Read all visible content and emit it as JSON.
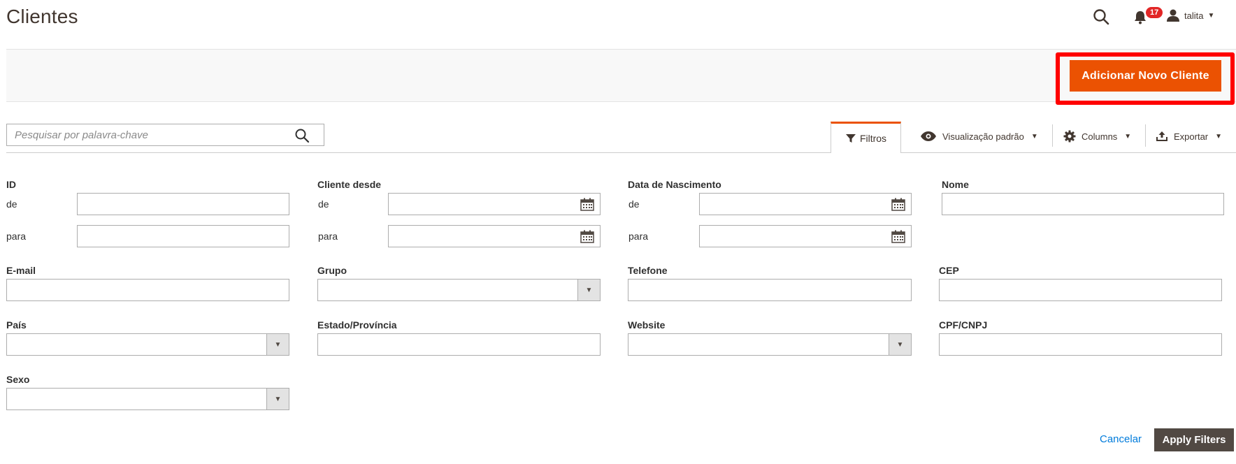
{
  "page": {
    "title": "Clientes"
  },
  "header": {
    "notifications_count": "17",
    "user_name": "talita"
  },
  "action_bar": {
    "add_button_label": "Adicionar Novo Cliente"
  },
  "search": {
    "placeholder": "Pesquisar por palavra-chave"
  },
  "toolbar": {
    "filters_label": "Filtros",
    "view_label": "Visualização padrão",
    "columns_label": "Columns",
    "export_label": "Exportar"
  },
  "filters": {
    "from_label": "de",
    "to_label": "para",
    "id": "ID",
    "customer_since": "Cliente desde",
    "birth_date": "Data de Nascimento",
    "name": "Nome",
    "email": "E-mail",
    "group": "Grupo",
    "phone": "Telefone",
    "zip": "CEP",
    "country": "País",
    "state": "Estado/Província",
    "website": "Website",
    "tax_id": "CPF/CNPJ",
    "gender": "Sexo"
  },
  "footer": {
    "cancel_label": "Cancelar",
    "apply_label": "Apply Filters"
  },
  "colors": {
    "accent": "#eb5202",
    "highlight": "#ff0000",
    "link": "#007bdb",
    "dark_button": "#514943",
    "badge": "#e22626"
  }
}
